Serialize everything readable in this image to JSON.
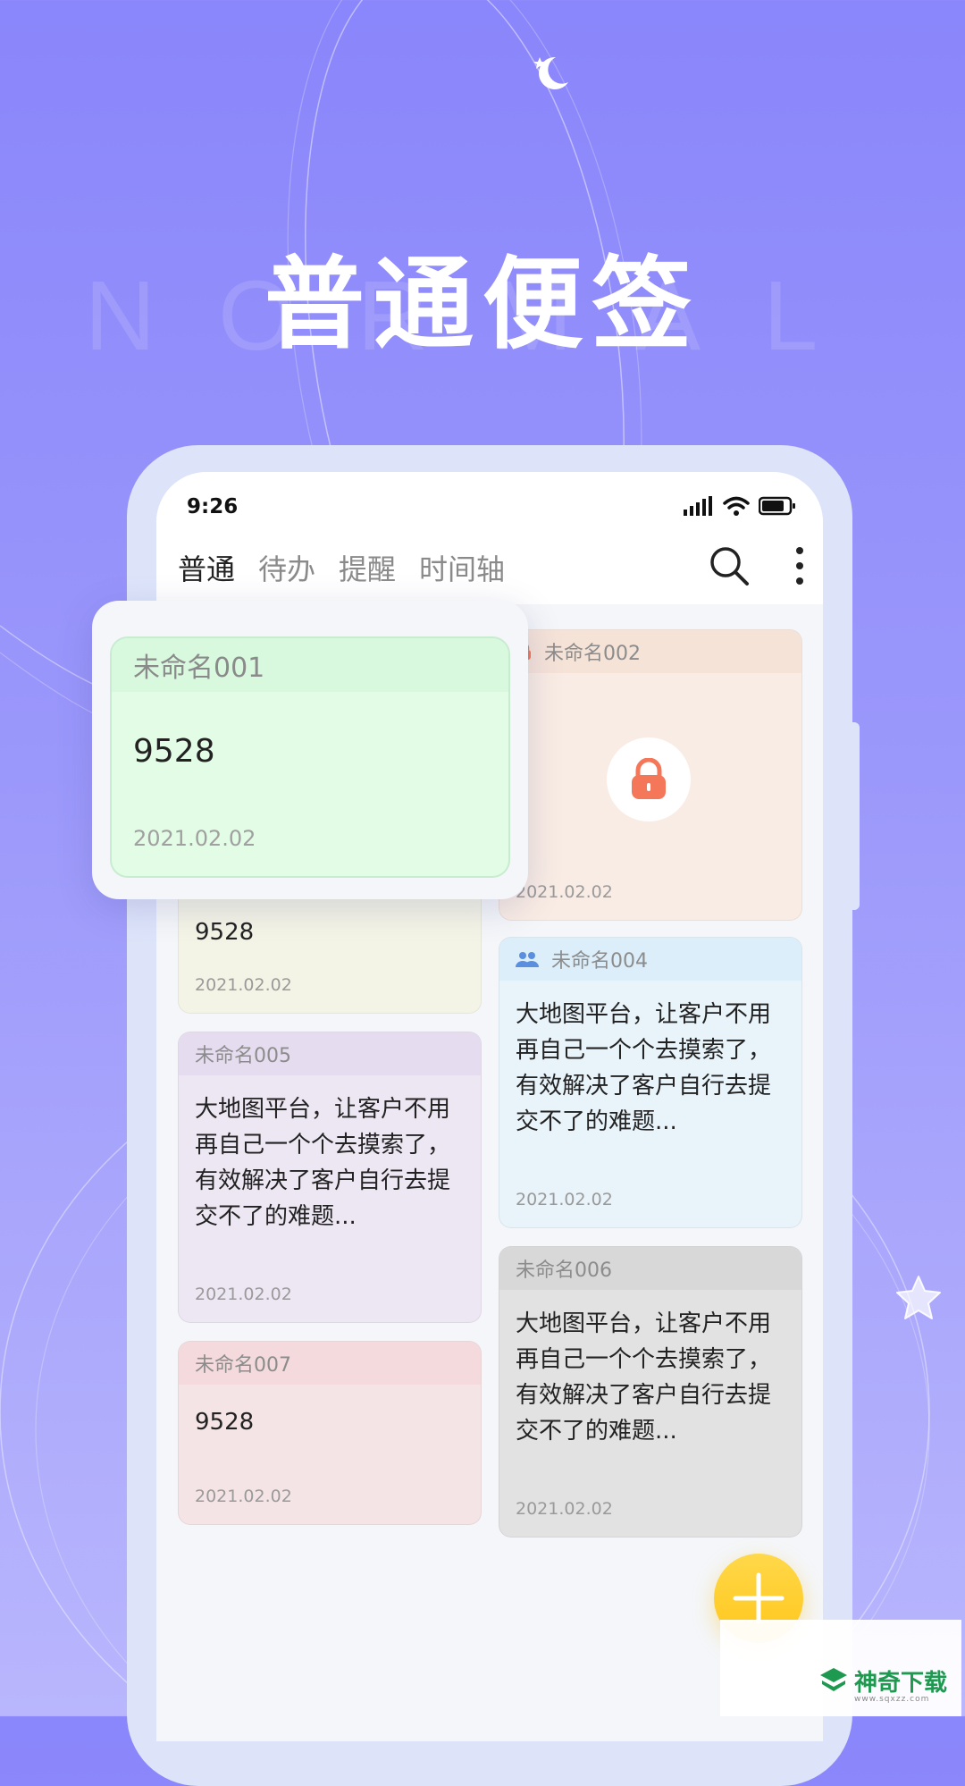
{
  "hero": {
    "bg_word": "NORMAL",
    "title": "普通便签"
  },
  "status_bar": {
    "time": "9:26",
    "icons": [
      "signal-icon",
      "wifi-icon",
      "battery-icon"
    ]
  },
  "tabs": [
    {
      "label": "普通",
      "active": true
    },
    {
      "label": "待办",
      "active": false
    },
    {
      "label": "提醒",
      "active": false
    },
    {
      "label": "时间轴",
      "active": false
    }
  ],
  "header_icons": [
    "search-icon",
    "more-vertical-icon"
  ],
  "popup_note": {
    "title": "未命名001",
    "content": "9528",
    "date": "2021.02.02",
    "color": "#e2fce5"
  },
  "notes": {
    "n002": {
      "title": "未命名002",
      "date": "2021.02.02",
      "locked": true,
      "color": "#f9ece4"
    },
    "n003": {
      "content": "9528",
      "date": "2021.02.02",
      "color": "#f4f4e6"
    },
    "n004": {
      "title": "未命名004",
      "content": "大地图平台，让客户不用再自己一个个去摸索了，有效解决了客户自行去提交不了的难题...",
      "date": "2021.02.02",
      "color": "#e8f3fa"
    },
    "n005": {
      "title": "未命名005",
      "content": "大地图平台，让客户不用再自己一个个去摸索了，有效解决了客户自行去提交不了的难题...",
      "date": "2021.02.02",
      "color": "#ede6f3"
    },
    "n006": {
      "title": "未命名006",
      "content": "大地图平台，让客户不用再自己一个个去摸索了，有效解决了客户自行去提交不了的难题...",
      "date": "2021.02.02",
      "color": "#e2e2e2"
    },
    "n007": {
      "title": "未命名007",
      "content": "9528",
      "date": "2021.02.02",
      "color": "#f5e4e6"
    }
  },
  "watermark": {
    "name": "神奇下载",
    "url": "www.sqxzz.com"
  },
  "colors": {
    "background": "#8a86fb",
    "accent_yellow": "#ffc61a",
    "lock_orange": "#f4775a"
  }
}
